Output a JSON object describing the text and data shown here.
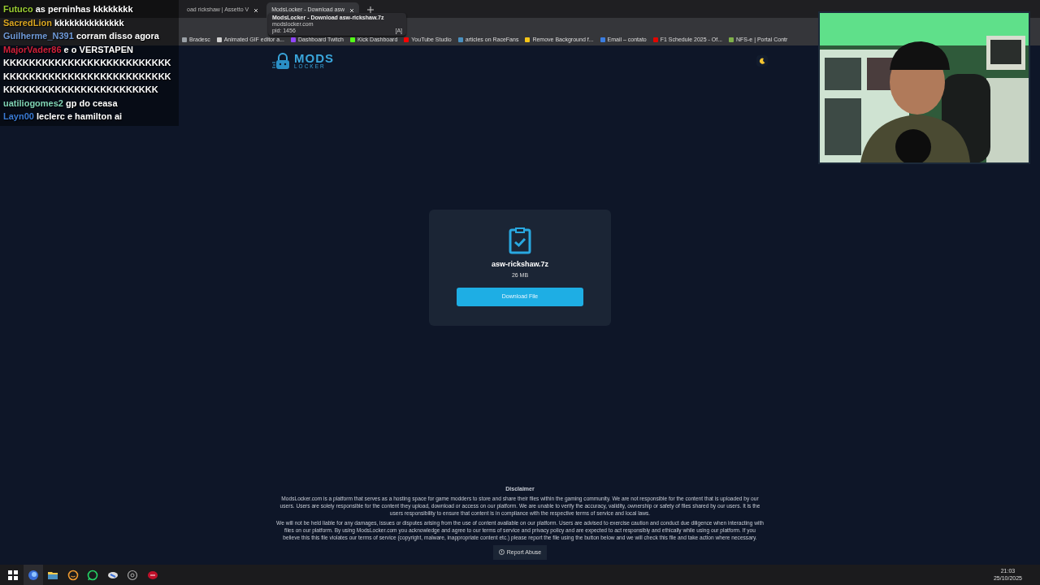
{
  "browser": {
    "tabs": [
      {
        "title": "oad rickshaw | Assetto V",
        "selected": false
      },
      {
        "title": "ModsLocker - Download asw",
        "selected": true
      }
    ],
    "tooltip": {
      "title": "ModsLocker - Download asw-rickshaw.7z",
      "host": "modslocker.com",
      "pid": "pid: 1456",
      "badge": "[A]"
    },
    "bookmarks": [
      {
        "label": "Bradesc",
        "color": "#9aa0a6"
      },
      {
        "label": "Animated GIF editor a...",
        "color": "#d0d0d0"
      },
      {
        "label": "Dashboard Twitch",
        "color": "#9146ff"
      },
      {
        "label": "Kick Dashboard",
        "color": "#53fc18"
      },
      {
        "label": "YouTube Studio",
        "color": "#ff0000"
      },
      {
        "label": "articles on RaceFans",
        "color": "#4a90c0"
      },
      {
        "label": "Remove Background f...",
        "color": "#f5c518"
      },
      {
        "label": "Email – contato",
        "color": "#3b7de0"
      },
      {
        "label": "F1 Schedule 2025 - Of...",
        "color": "#e10600"
      },
      {
        "label": "NFS-e | Portal Contr",
        "color": "#7fb04a"
      }
    ]
  },
  "page": {
    "logo": {
      "word": "MODS",
      "sub": "LOCKER"
    },
    "file": {
      "name": "asw-rickshaw.7z",
      "size": "26 MB",
      "button": "Download File"
    },
    "disclaimer": {
      "title": "Disclaimer",
      "paragraphs": [
        "ModsLocker.com is a platform that serves as a hosting space for game modders to store and share their files within the gaming community. We are not responsible for the content that is uploaded by our users. Users are solely responsible for the content they upload, download or access on our platform. We are unable to verify the accuracy, validity, ownership or safety of files shared by our users. It is the users responsibility to ensure that content is in compliance with the respective terms of service and local laws.",
        "We will not be held liable for any damages, issues or disputes arising from the use of content available on our platform. Users are advised to exercise caution and conduct due diligence when interacting with files on our platform. By using ModsLocker.com you acknowledge and agree to our terms of service and privacy policy and are expected to act responsibly and ethically while using our platform. If you believe this this file violates our terms of service (copyright, malware, inappropriate content etc.) please report the file using the button below and we will check this file and take action where necessary."
      ]
    },
    "report_button": "Report Abuse"
  },
  "chat": [
    {
      "user": "Futuco",
      "color": "#9acd32",
      "message": "as perninhas kkkkkkkk"
    },
    {
      "user": "SacredLion",
      "color": "#daa520",
      "message": "kkkkkkkkkkkkkk"
    },
    {
      "user": "Guilherme_N391",
      "color": "#6f9ad8",
      "message": "corram disso agora"
    },
    {
      "user": "MajorVader86",
      "color": "#d0203a",
      "message": "e o VERSTAPEN",
      "more": [
        "KKKKKKKKKKKKKKKKKKKKKKKKKK",
        "KKKKKKKKKKKKKKKKKKKKKKKKKK",
        "KKKKKKKKKKKKKKKKKKKKKKKK"
      ]
    },
    {
      "user": "uatiliogomes2",
      "color": "#7fd3b5",
      "message": "gp do ceasa"
    },
    {
      "user": "Layn00",
      "color": "#3a7bd5",
      "message": "leclerc e hamilton ai"
    }
  ],
  "taskbar": {
    "items": [
      {
        "kind": "start",
        "selected": false
      },
      {
        "kind": "browser",
        "selected": true
      },
      {
        "kind": "folder",
        "selected": false
      },
      {
        "kind": "chat",
        "selected": false
      },
      {
        "kind": "whatsapp",
        "selected": false
      },
      {
        "kind": "app",
        "selected": false
      },
      {
        "kind": "game",
        "selected": false
      },
      {
        "kind": "red",
        "selected": false
      }
    ],
    "time": "21:03",
    "date": "25/10/2025"
  }
}
